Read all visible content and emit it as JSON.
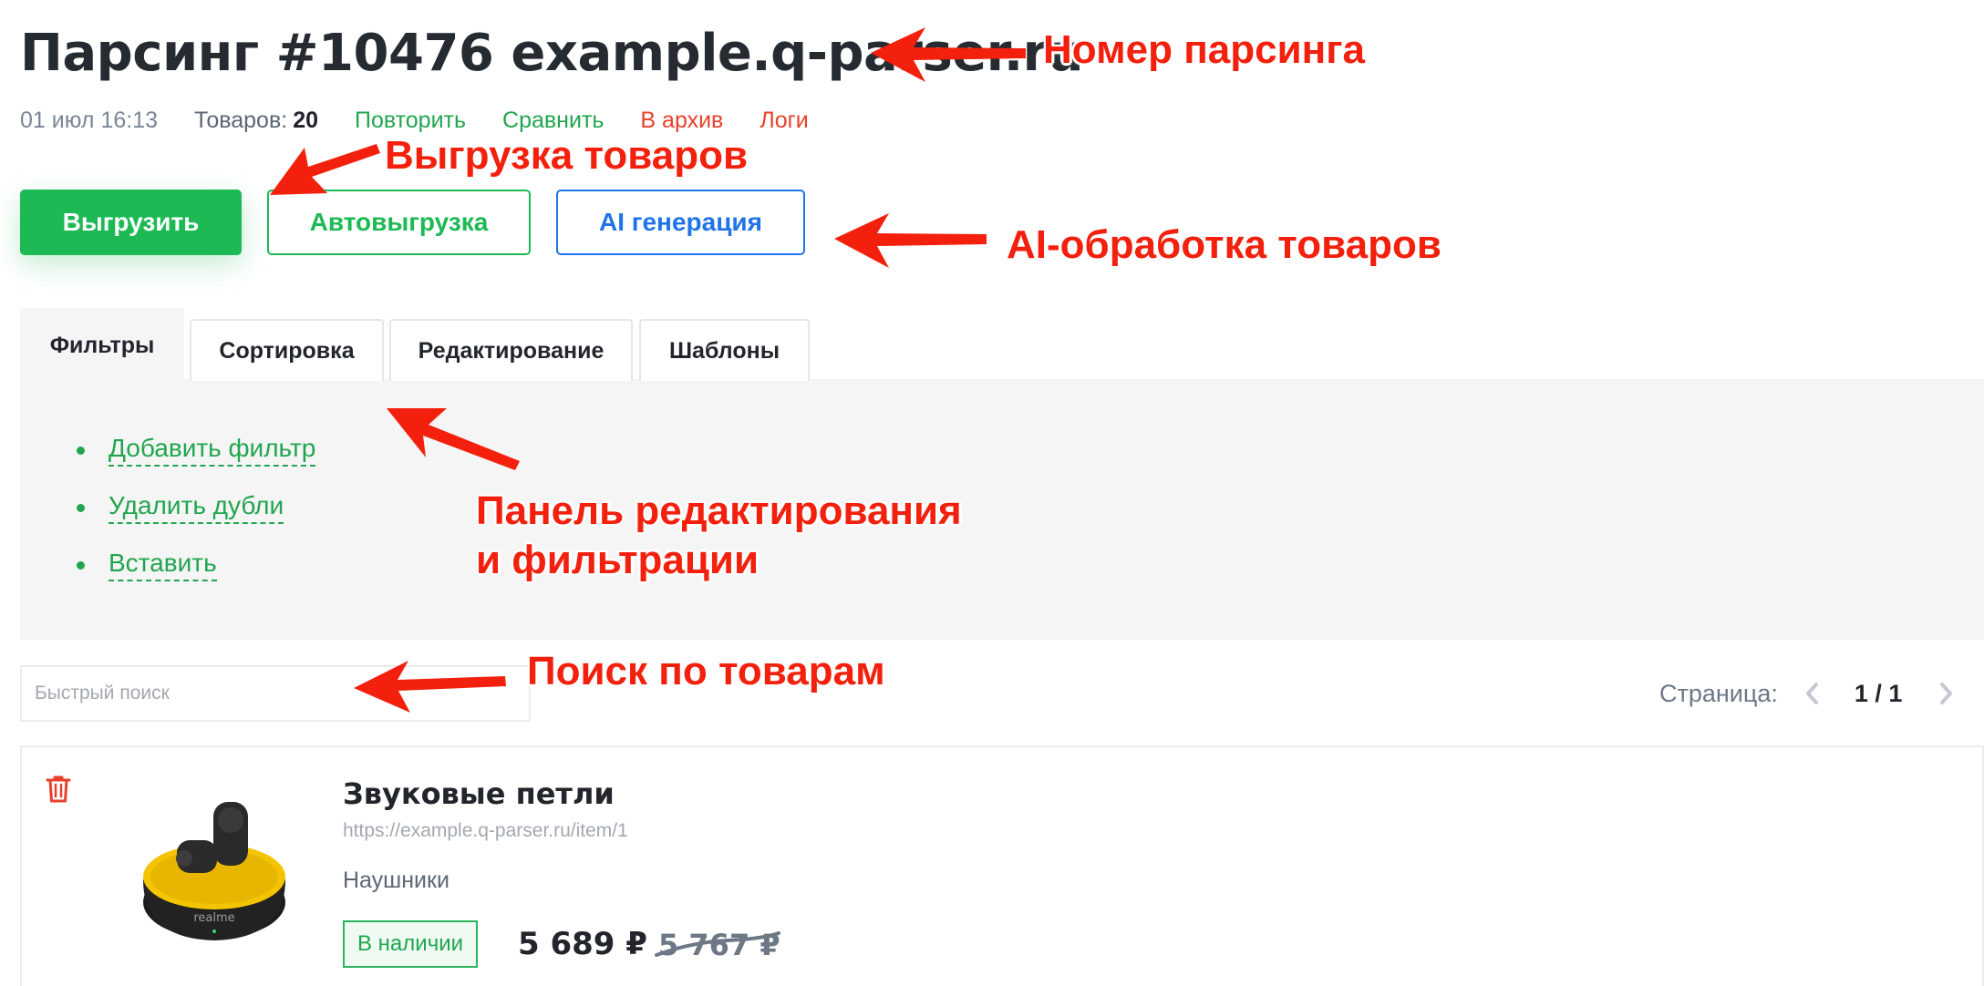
{
  "header": {
    "title": "Парсинг #10476 example.q-parser.ru",
    "date": "01 июл 16:13",
    "products_label": "Товаров:",
    "products_count": "20",
    "actions": {
      "repeat": "Повторить",
      "compare": "Сравнить",
      "archive": "В архив",
      "logs": "Логи"
    }
  },
  "buttons": {
    "export": "Выгрузить",
    "autoexport": "Автовыгрузка",
    "ai": "AI генерация"
  },
  "tabs": [
    {
      "label": "Фильтры",
      "active": true
    },
    {
      "label": "Сортировка",
      "active": false
    },
    {
      "label": "Редактирование",
      "active": false
    },
    {
      "label": "Шаблоны",
      "active": false
    }
  ],
  "panel": {
    "items": [
      "Добавить фильтр",
      "Удалить дубли",
      "Вставить"
    ]
  },
  "search": {
    "placeholder": "Быстрый поиск",
    "value": ""
  },
  "pagination": {
    "label": "Страница:",
    "value": "1 / 1"
  },
  "product": {
    "name": "Звуковые петли",
    "url": "https://example.q-parser.ru/item/1",
    "category": "Наушники",
    "stock": "В наличии",
    "price": "5 689 ₽",
    "old_price": "5 767 ₽",
    "image_brand": "realme"
  },
  "annotations": {
    "parse_number": "Номер парсинга",
    "export": "Выгрузка товаров",
    "ai": "AI-обработка товаров",
    "panel_line1": "Панель редактирования",
    "panel_line2": "и фильтрации",
    "search": "Поиск по товарам"
  },
  "colors": {
    "green": "#1cb954",
    "blue": "#1e74e8",
    "red": "#e8412b",
    "annotation": "#f2200c"
  },
  "icons": [
    "trash-icon",
    "chevron-left-icon",
    "chevron-right-icon",
    "arrow-icon"
  ]
}
